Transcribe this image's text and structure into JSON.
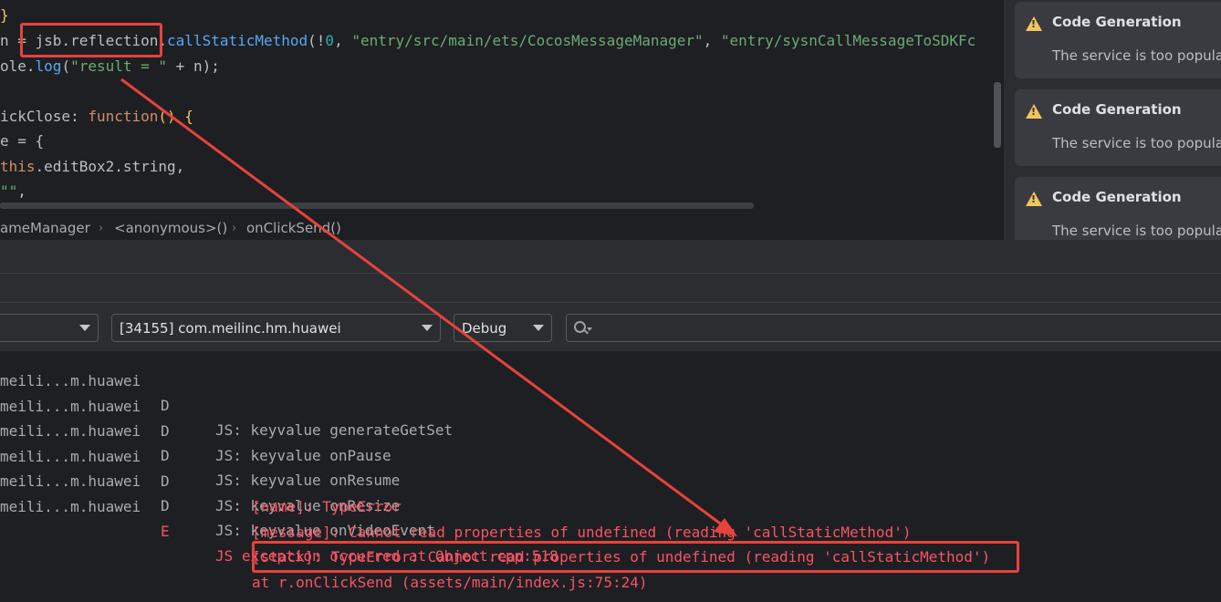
{
  "editor": {
    "lines": [
      {
        "brace": "}"
      },
      {
        "p1": "n = ",
        "p2": "jsb.reflection",
        "p3": ".",
        "p4": "callStaticMethod",
        "p5": "(!",
        "p6": "0",
        "p7": ", ",
        "p8": "\"entry/src/main/ets/CocosMessageManager\"",
        "p9": ", ",
        "p10": "\"entry/sysnCallMessageToSDKFc"
      },
      {
        "p1": "ole.",
        "p2": "log",
        "p3": "(",
        "p4": "\"result = \"",
        "p5": " + n);"
      },
      {
        "p1": "ickClose: ",
        "p2": "function",
        "p3": "() {"
      },
      {
        "p1": "e = {"
      },
      {
        "p1": "this",
        "p2": ".editBox2.string,"
      },
      {
        "p1": "\"\"",
        "p2": ","
      }
    ]
  },
  "breadcrumb": {
    "items": [
      "ameManager",
      "<anonymous>()",
      "onClickSend()"
    ]
  },
  "notifications": [
    {
      "title": "Code Generation",
      "body": "The service is too popular"
    },
    {
      "title": "Code Generation",
      "body": "The service is too popular"
    },
    {
      "title": "Code Generation",
      "body": "The service is too popular"
    }
  ],
  "filters": {
    "process": "[34155] com.meilinc.hm.huawei",
    "level": "Debug",
    "search_value": ""
  },
  "log": {
    "rows": [
      {
        "tag": "meili...m.huawei",
        "level": "D",
        "msg": "JS: keyvalue generateGetSet",
        "error": false
      },
      {
        "tag": "meili...m.huawei",
        "level": "D",
        "msg": "JS: keyvalue onPause",
        "error": false
      },
      {
        "tag": "meili...m.huawei",
        "level": "D",
        "msg": "JS: keyvalue onResume",
        "error": false
      },
      {
        "tag": "meili...m.huawei",
        "level": "D",
        "msg": "JS: keyvalue onResize",
        "error": false
      },
      {
        "tag": "meili...m.huawei",
        "level": "D",
        "msg": "JS: keyvalue onVideoEvent",
        "error": false
      },
      {
        "tag": "meili...m.huawei",
        "level": "E",
        "msg": "JS exception occurred at Object.cpp:518",
        "error": true
      }
    ],
    "continuation": [
      "[name]: TypeError",
      "[message]: Cannot read properties of undefined (reading 'callStaticMethod')",
      "[stack]: TypeError: Cannot read properties of undefined (reading 'callStaticMethod')",
      "at r.onClickSend (assets/main/index.js:75:24)"
    ]
  },
  "colors": {
    "annotation": "#e8423c",
    "error_text": "#f75464",
    "warning_icon": "#f2c55c"
  }
}
